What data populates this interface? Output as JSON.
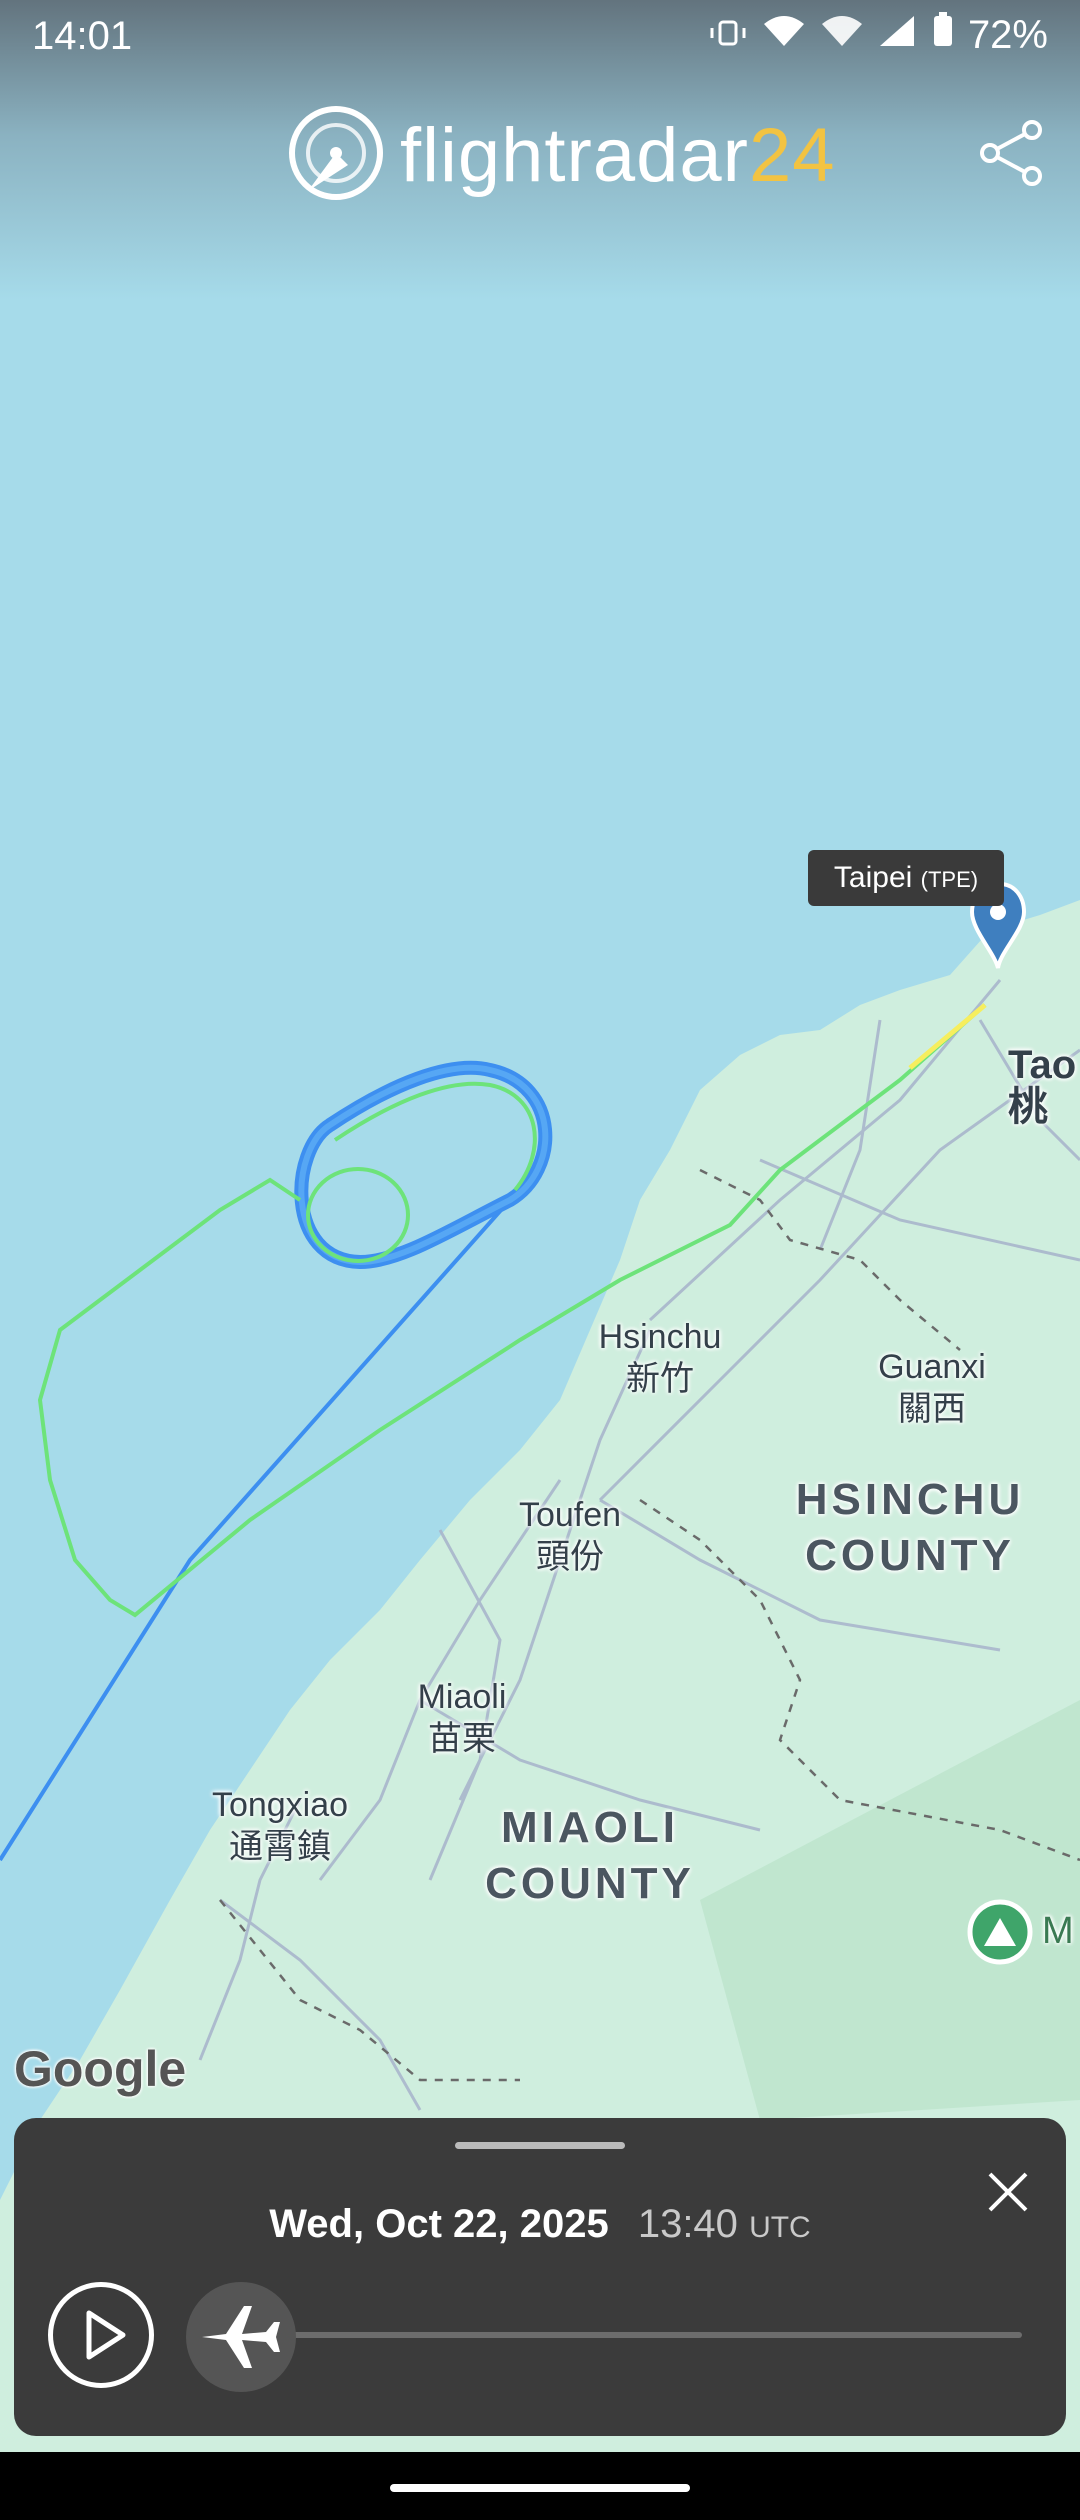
{
  "status_bar": {
    "time": "14:01",
    "battery": "72%"
  },
  "header": {
    "brand_main": "flightradar",
    "brand_suffix": "24",
    "share_icon": "share-icon"
  },
  "map": {
    "airport_tooltip": {
      "name": "Taipei",
      "code": "(TPE)"
    },
    "labels": {
      "taoyuan_partial": "Tao",
      "taoyuan_partial_zh": "桃",
      "hsinchu": "Hsinchu",
      "hsinchu_zh": "新竹",
      "guanxi": "Guanxi",
      "guanxi_zh": "關西",
      "hsinchu_county_1": "HSINCHU",
      "hsinchu_county_2": "COUNTY",
      "toufen": "Toufen",
      "toufen_zh": "頭份",
      "miaoli": "Miaoli",
      "miaoli_zh": "苗栗",
      "tongxiao": "Tongxiao",
      "tongxiao_zh": "通霄鎮",
      "miaoli_county_1": "MIAOLI",
      "miaoli_county_2": "COUNTY",
      "park_partial": "M"
    },
    "attribution": "Google",
    "colors": {
      "sea": "#a6dbea",
      "land": "#cfeede",
      "track_green": "#6de37a",
      "track_yellow": "#f6ee5e",
      "track_blue": "#3d8ff0",
      "marker": "#3f7fbf"
    }
  },
  "playback": {
    "date": "Wed, Oct 22, 2025",
    "time": "13:40",
    "timezone": "UTC",
    "progress_fraction": 0.0
  }
}
